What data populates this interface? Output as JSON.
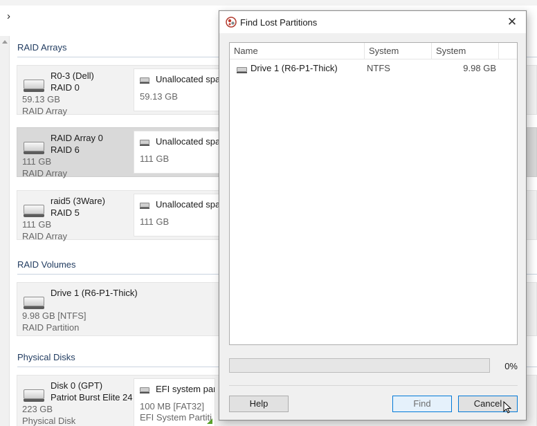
{
  "background": {
    "sections": {
      "raid_arrays": "RAID Arrays",
      "raid_volumes": "RAID Volumes",
      "physical_disks": "Physical Disks"
    },
    "raid_arrays": [
      {
        "name": "R0-3 (Dell)",
        "type": "RAID 0",
        "size": "59.13 GB",
        "kind": "RAID Array",
        "partition": {
          "label": "Unallocated spac",
          "size": "59.13 GB"
        }
      },
      {
        "name": "RAID Array 0",
        "type": "RAID 6",
        "size": "111 GB",
        "kind": "RAID Array",
        "partition": {
          "label": "Unallocated spac",
          "size": "111 GB"
        }
      },
      {
        "name": "raid5 (3Ware)",
        "type": "RAID 5",
        "size": "111 GB",
        "kind": "RAID Array",
        "partition": {
          "label": "Unallocated spac",
          "size": "111 GB"
        }
      }
    ],
    "raid_volume": {
      "name": "Drive 1 (R6-P1-Thick)",
      "size": "9.98 GB [NTFS]",
      "kind": "RAID Partition"
    },
    "physical_disk": {
      "name": "Disk 0 (GPT)",
      "model": "Patriot Burst Elite 24",
      "size": "223 GB",
      "kind": "Physical Disk",
      "partition": {
        "label": "EFI system par",
        "size": "100 MB [FAT32]",
        "type": "EFI System Partiti"
      }
    }
  },
  "dialog": {
    "title": "Find Lost Partitions",
    "columns": [
      "Name",
      "System",
      "System"
    ],
    "rows": [
      {
        "name": "Drive 1 (R6-P1-Thick)",
        "fs": "NTFS",
        "size": "9.98 GB"
      }
    ],
    "progress": {
      "percent_label": "0%",
      "value": 0
    },
    "buttons": {
      "help": "Help",
      "find": "Find",
      "cancel": "Cancel"
    }
  },
  "colors": {
    "accent": "#0078d7",
    "section_text": "#1f3a5f",
    "progress": "#06b025"
  },
  "icons": [
    "chevron-right-icon",
    "drive-icon",
    "close-icon",
    "app-icon",
    "cursor-icon"
  ]
}
